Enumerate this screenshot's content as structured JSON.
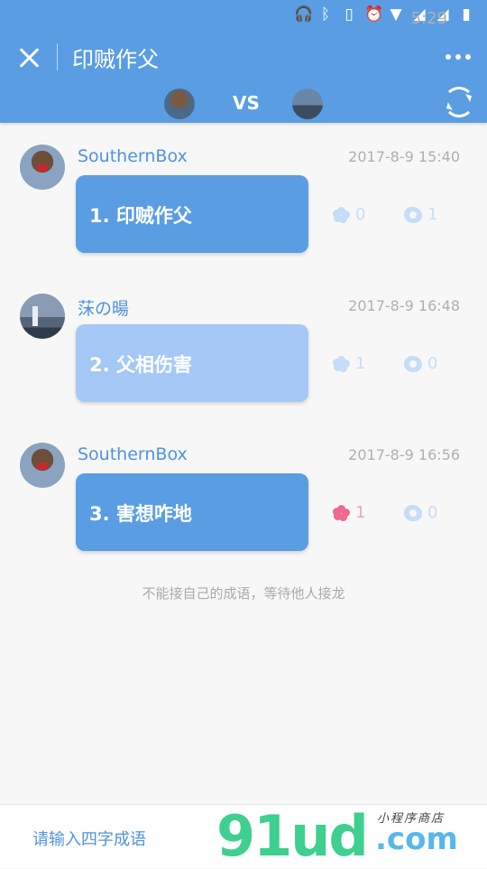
{
  "status_bar": {
    "icons": [
      "headphones-icon",
      "bluetooth-icon",
      "vibrate-icon",
      "alarm-icon",
      "wifi-icon",
      "signal-icon",
      "signal-icon",
      "battery-icon"
    ],
    "time": "5:29"
  },
  "header": {
    "title": "印贼作父",
    "vs_label": "VS"
  },
  "messages": [
    {
      "user": "SouthernBox",
      "time": "2017-8-9 15:40",
      "text": "1. 印贼作父",
      "flowers": "0",
      "pearls": "1"
    },
    {
      "user": "莯の暘",
      "time": "2017-8-9 16:48",
      "text": "2. 父相伤害",
      "flowers": "1",
      "pearls": "0"
    },
    {
      "user": "SouthernBox",
      "time": "2017-8-9 16:56",
      "text": "3. 害想咋地",
      "flowers": "1",
      "pearls": "0"
    }
  ],
  "hint": "不能接自己的成语，等待他人接龙",
  "input": {
    "placeholder": "请输入四字成语"
  },
  "watermark": {
    "big": "91ud",
    "small": ".com",
    "tag": "小程序商店"
  },
  "colors": {
    "primary": "#5a9de3",
    "bubble_light": "#a6c8f7",
    "flower_active": "#f0698f"
  }
}
